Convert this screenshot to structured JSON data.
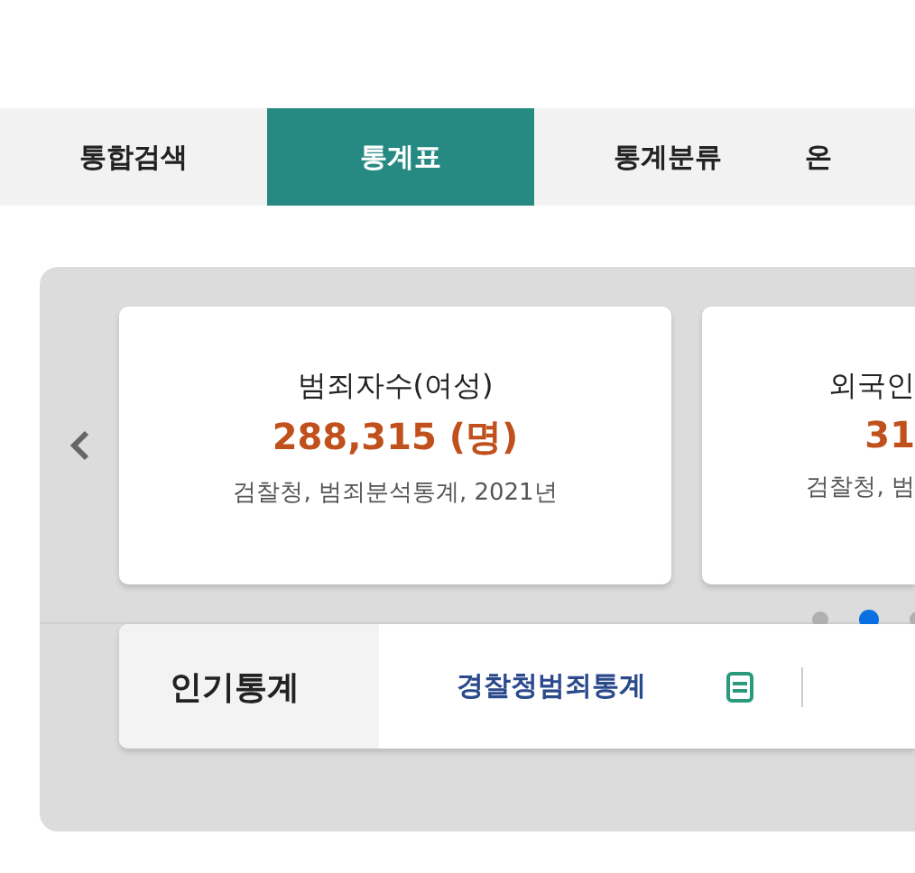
{
  "tabs": [
    {
      "label": "통합검색",
      "selected": false
    },
    {
      "label": "통계표",
      "selected": true
    },
    {
      "label": "통계분류",
      "selected": false
    },
    {
      "label": "온",
      "selected": false
    }
  ],
  "carousel": {
    "cards": [
      {
        "title": "범죄자수(여성)",
        "value": "288,315 (명)",
        "source": "검찰청, 범죄분석통계, 2021년"
      },
      {
        "title": "외국인",
        "value": "31",
        "source": "검찰청, 범"
      }
    ],
    "dots": [
      {
        "selected": false
      },
      {
        "selected": true
      },
      {
        "selected": false
      }
    ]
  },
  "popular": {
    "label": "인기통계",
    "items": [
      {
        "label": "경찰청범죄통계"
      }
    ]
  }
}
